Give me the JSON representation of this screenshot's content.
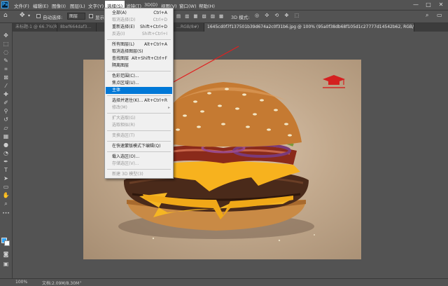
{
  "app": {
    "logo": "Ps"
  },
  "menu": {
    "items": [
      {
        "label": "文件(F)"
      },
      {
        "label": "编辑(E)"
      },
      {
        "label": "图像(I)"
      },
      {
        "label": "图层(L)"
      },
      {
        "label": "文字(Y)"
      },
      {
        "label": "选择(S)"
      },
      {
        "label": "滤镜(T)"
      },
      {
        "label": "3D(D)"
      },
      {
        "label": "视图(V)"
      },
      {
        "label": "窗口(W)"
      },
      {
        "label": "帮助(H)"
      }
    ],
    "window_controls": {
      "minimize": "—",
      "maximize": "□",
      "close": "✕"
    }
  },
  "options_bar": {
    "auto_select_label": "自动选择:",
    "layer_select_value": "图层",
    "show_transform_label": "显示",
    "mode_label": "3D 模式:"
  },
  "tabs": [
    {
      "label": "未标题-1 @ 66.7%(RGB/8)"
    },
    {
      "label": "8bef664daf3…"
    },
    {
      "label": "…RGB/8#)"
    },
    {
      "label": "1645cd0f7f137501b39d674a2c0f31b6.jpg @ 100% (95a0f38db68f105d1c27777d14542b62, RGB/8#) *"
    }
  ],
  "select_menu": {
    "items": [
      {
        "label": "全部(A)",
        "shortcut": "Ctrl+A",
        "enabled": true
      },
      {
        "label": "取消选择(D)",
        "shortcut": "Ctrl+D",
        "enabled": false
      },
      {
        "label": "重新选择(E)",
        "shortcut": "Shift+Ctrl+D",
        "enabled": true
      },
      {
        "label": "反选(I)",
        "shortcut": "Shift+Ctrl+I",
        "enabled": false
      },
      {
        "label": "所有图层(L)",
        "shortcut": "Alt+Ctrl+A",
        "enabled": true
      },
      {
        "label": "取消选择图层(S)",
        "shortcut": "",
        "enabled": true
      },
      {
        "label": "查找图层",
        "shortcut": "Alt+Shift+Ctrl+F",
        "enabled": true
      },
      {
        "label": "隔离图层",
        "shortcut": "",
        "enabled": true
      },
      {
        "label": "色彩范围(C)...",
        "shortcut": "",
        "enabled": true
      },
      {
        "label": "焦点区域(U)...",
        "shortcut": "",
        "enabled": true
      },
      {
        "label": "主体",
        "shortcut": "",
        "enabled": true,
        "highlighted": true
      },
      {
        "label": "选择并遮住(K)...",
        "shortcut": "Alt+Ctrl+R",
        "enabled": true
      },
      {
        "label": "修改(M)",
        "shortcut": "",
        "enabled": false,
        "submenu": true
      },
      {
        "label": "扩大选取(G)",
        "shortcut": "",
        "enabled": false
      },
      {
        "label": "选取相似(R)",
        "shortcut": "",
        "enabled": false
      },
      {
        "label": "变换选区(T)",
        "shortcut": "",
        "enabled": false
      },
      {
        "label": "在快速蒙版模式下编辑(Q)",
        "shortcut": "",
        "enabled": true
      },
      {
        "label": "载入选区(O)...",
        "shortcut": "",
        "enabled": true
      },
      {
        "label": "存储选区(V)...",
        "shortcut": "",
        "enabled": false
      },
      {
        "label": "新建 3D 模型(3)",
        "shortcut": "",
        "enabled": false
      }
    ]
  },
  "status": {
    "zoom": "100%",
    "doc_size": "文档:2.09M/8.30M"
  },
  "colors": {
    "accent": "#0078d7",
    "foreground_swatch": "#31a8ff",
    "annotation_arrow": "#e02020"
  }
}
